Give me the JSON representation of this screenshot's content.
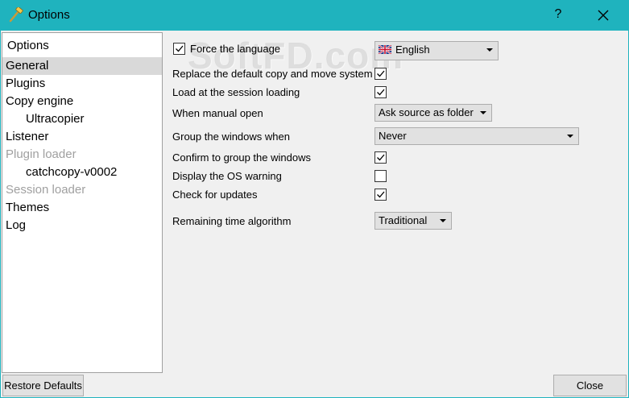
{
  "window": {
    "title": "Options",
    "help_label": "?",
    "app_icon": "hammer-icon",
    "close_icon": "close-icon"
  },
  "tree": {
    "header": "Options",
    "items": [
      {
        "label": "General",
        "selected": true
      },
      {
        "label": "Plugins"
      },
      {
        "label": "Copy engine"
      },
      {
        "label": "Ultracopier",
        "child": true
      },
      {
        "label": "Listener"
      },
      {
        "label": "Plugin loader",
        "disabled": true
      },
      {
        "label": "catchcopy-v0002",
        "child": true
      },
      {
        "label": "Session loader",
        "disabled": true
      },
      {
        "label": "Themes"
      },
      {
        "label": "Log"
      }
    ]
  },
  "general": {
    "force_language": {
      "label": "Force the language",
      "checked": true
    },
    "language": {
      "value": "English",
      "icon": "uk-flag-icon"
    },
    "replace_copy_move": {
      "label": "Replace the default copy and move system",
      "checked": true
    },
    "load_session": {
      "label": "Load at the session loading",
      "checked": true
    },
    "manual_open": {
      "label": "When manual open",
      "value": "Ask source as folder"
    },
    "group_windows": {
      "label": "Group the windows when",
      "value": "Never"
    },
    "confirm_group": {
      "label": "Confirm to group the windows",
      "checked": true
    },
    "os_warning": {
      "label": "Display the OS warning",
      "checked": false
    },
    "check_updates": {
      "label": "Check for updates",
      "checked": true
    },
    "remaining_time": {
      "label": "Remaining time algorithm",
      "value": "Traditional"
    }
  },
  "buttons": {
    "restore_defaults": "Restore Defaults",
    "close": "Close"
  },
  "watermark": "SoftFD.com",
  "colors": {
    "titlebar": "#1fb3be",
    "selection": "#d9d9d9",
    "disabled_text": "#a0a0a0"
  }
}
